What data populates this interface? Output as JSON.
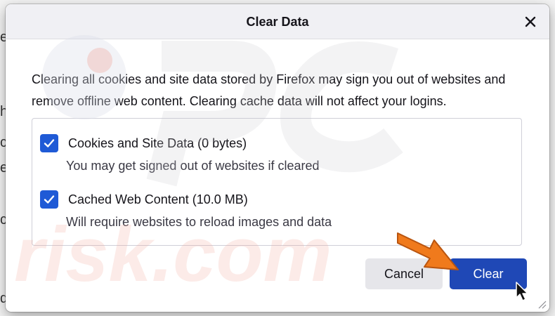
{
  "background": {
    "fragments": [
      "e",
      "h",
      "c",
      "e",
      "c",
      "d"
    ]
  },
  "dialog": {
    "title": "Clear Data",
    "description": "Clearing all cookies and site data stored by Firefox may sign you out of websites and remove offline web content. Clearing cache data will not affect your logins.",
    "options": [
      {
        "label": "Cookies and Site Data (0 bytes)",
        "description": "You may get signed out of websites if cleared",
        "checked": true
      },
      {
        "label": "Cached Web Content (10.0 MB)",
        "description": "Will require websites to reload images and data",
        "checked": true
      }
    ],
    "buttons": {
      "cancel_label": "Cancel",
      "clear_label": "Clear"
    },
    "icons": {
      "close": "close-icon",
      "checkbox": "checkmark-icon",
      "resize": "resize-grip-icon"
    }
  },
  "colors": {
    "accent": "#1f5ad6",
    "primary_button": "#1f48b6",
    "arrow": "#f07a1c"
  },
  "watermark": "risk.com"
}
